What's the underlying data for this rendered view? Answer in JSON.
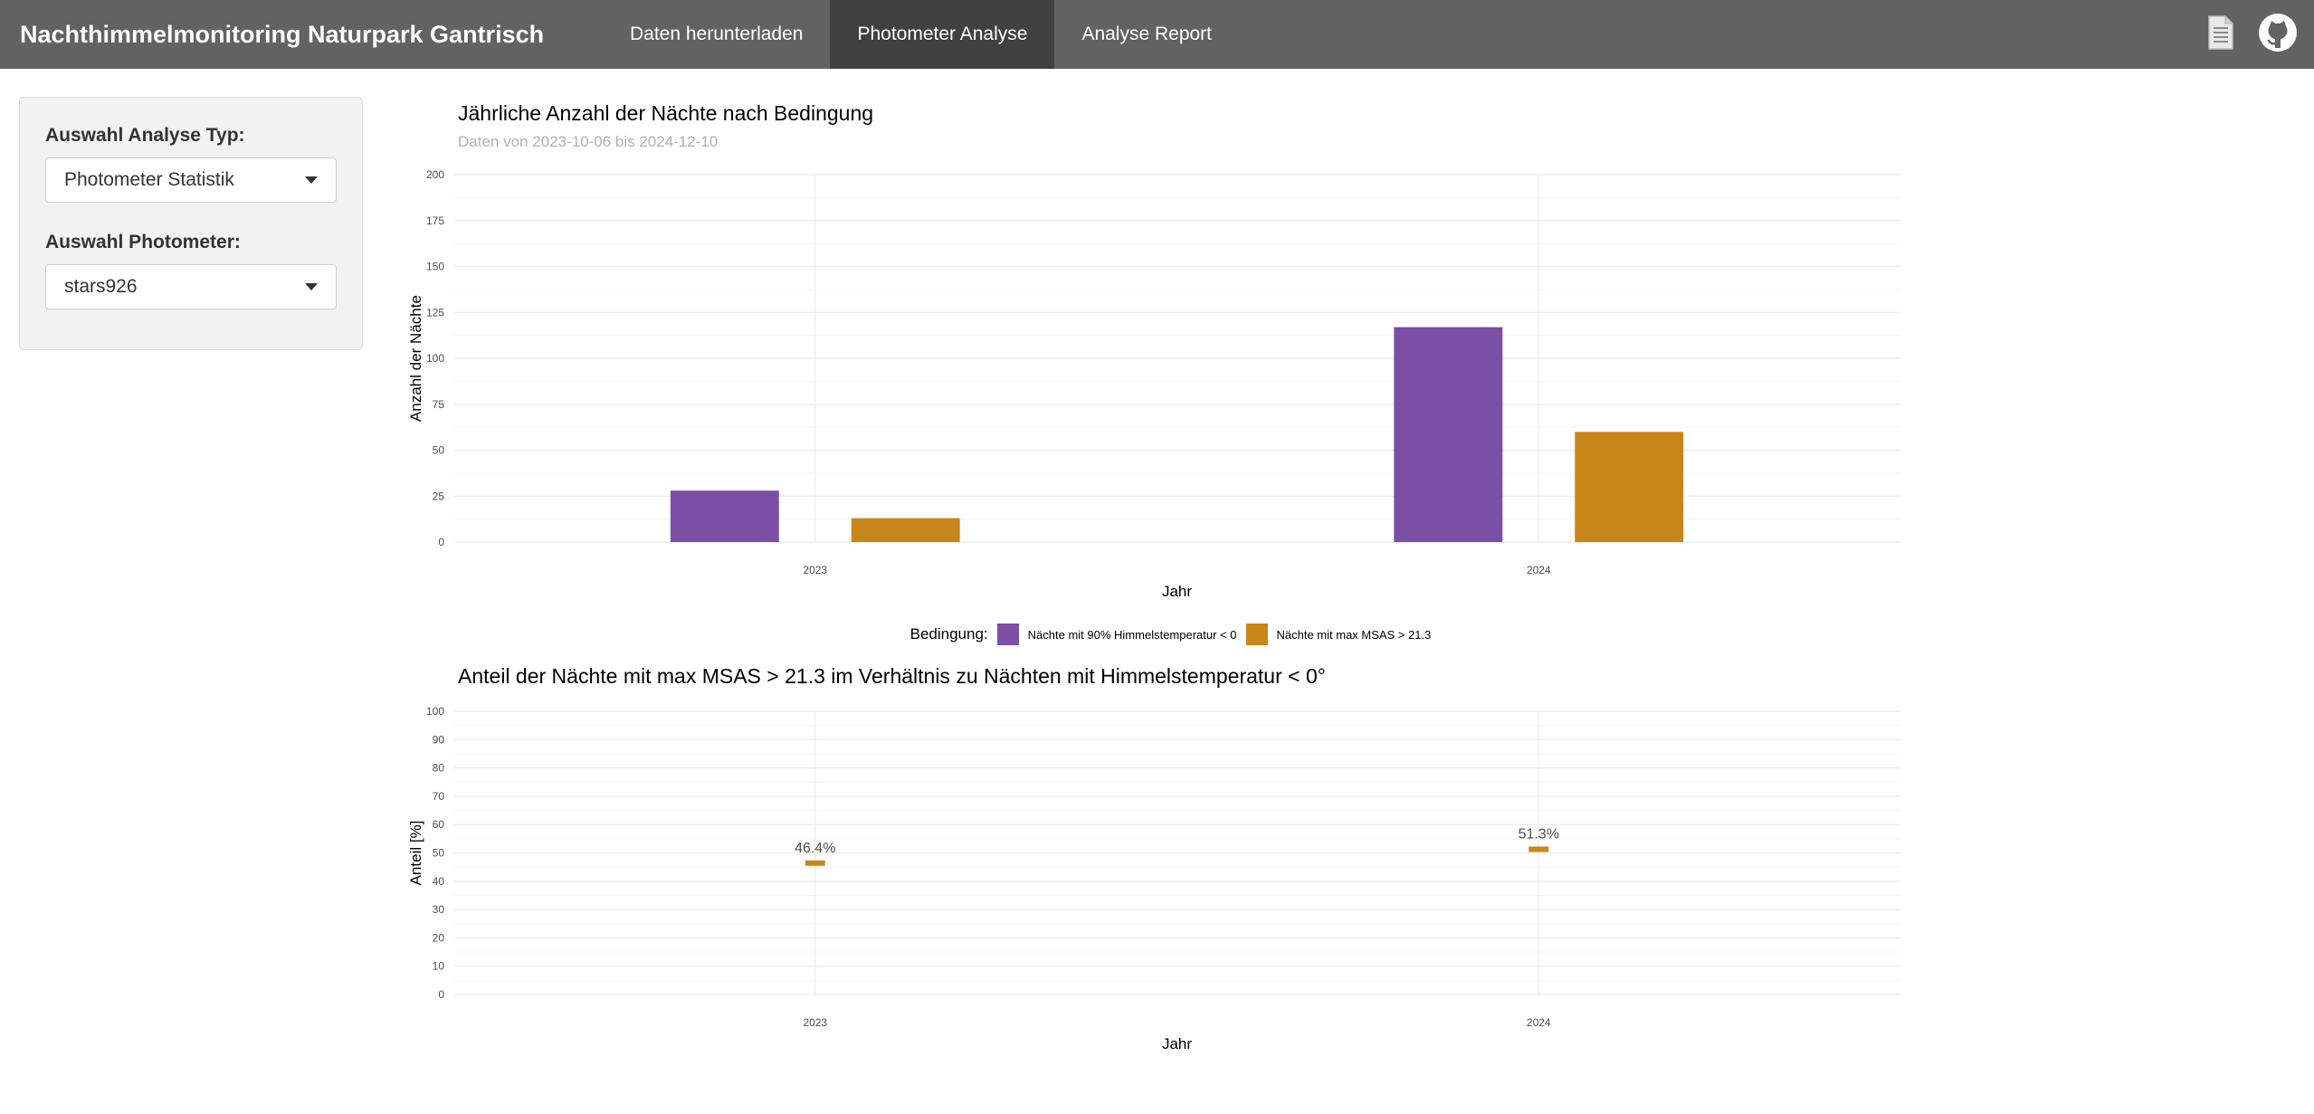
{
  "app": {
    "title": "Nachthimmelmonitoring Naturpark Gantrisch",
    "tabs": [
      {
        "label": "Daten herunterladen",
        "active": false
      },
      {
        "label": "Photometer Analyse",
        "active": true
      },
      {
        "label": "Analyse Report",
        "active": false
      }
    ],
    "icons": [
      "document-icon",
      "github-icon"
    ]
  },
  "sidebar": {
    "analysis_type_label": "Auswahl Analyse Typ:",
    "analysis_type_value": "Photometer Statistik",
    "photometer_label": "Auswahl Photometer:",
    "photometer_value": "stars926"
  },
  "colors": {
    "navbar": "#626262",
    "nav_active": "#414141",
    "series_purple": "#7b4fa6",
    "series_orange": "#c8861a"
  },
  "chart_data": [
    {
      "type": "bar",
      "title": "Jährliche Anzahl der Nächte nach Bedingung",
      "subtitle": "Daten von 2023-10-06 bis 2024-12-10",
      "xlabel": "Jahr",
      "ylabel": "Anzahl der Nächte",
      "categories": [
        "2023",
        "2024"
      ],
      "ylim": [
        0,
        200
      ],
      "yticks": [
        0,
        25,
        50,
        75,
        100,
        125,
        150,
        175,
        200
      ],
      "grid": true,
      "legend": {
        "title": "Bedingung:",
        "placement": "bottom",
        "entries": [
          "Nächte mit 90% Himmelstemperatur < 0",
          "Nächte mit max MSAS > 21.3"
        ]
      },
      "series": [
        {
          "name": "Nächte mit 90% Himmelstemperatur < 0",
          "color": "#7b4fa6",
          "values": [
            28,
            117
          ]
        },
        {
          "name": "Nächte mit max MSAS > 21.3",
          "color": "#c8861a",
          "values": [
            13,
            60
          ]
        }
      ]
    },
    {
      "type": "scatter",
      "title": "Anteil der Nächte mit max MSAS > 21.3 im Verhältnis zu Nächten mit Himmelstemperatur < 0°",
      "xlabel": "Jahr",
      "ylabel": "Anteil [%]",
      "categories": [
        "2023",
        "2024"
      ],
      "ylim": [
        0,
        100
      ],
      "yticks": [
        0,
        10,
        20,
        30,
        40,
        50,
        60,
        70,
        80,
        90,
        100
      ],
      "grid": true,
      "series": [
        {
          "color": "#c8861a",
          "values": [
            46.4,
            51.3
          ],
          "labels": [
            "46.4%",
            "51.3%"
          ]
        }
      ]
    }
  ]
}
